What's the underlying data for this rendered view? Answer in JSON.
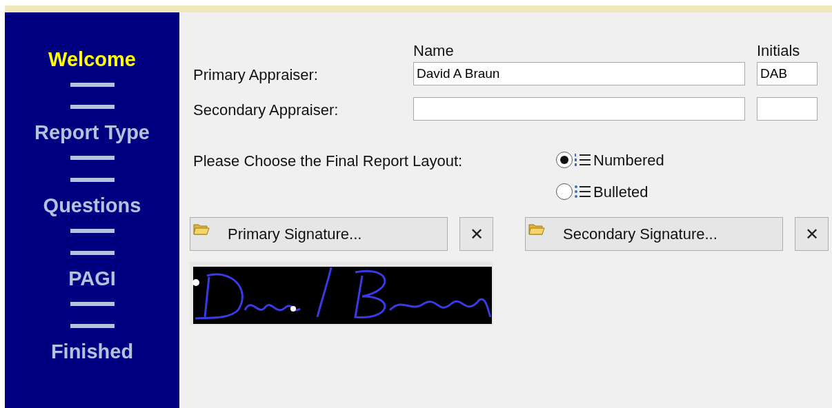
{
  "sidebar": {
    "items": [
      {
        "label": "Welcome",
        "selected": true
      },
      {
        "label": "Report Type",
        "selected": false
      },
      {
        "label": "Questions",
        "selected": false
      },
      {
        "label": "PAGI",
        "selected": false
      },
      {
        "label": "Finished",
        "selected": false
      }
    ]
  },
  "appraisers": {
    "name_header": "Name",
    "initials_header": "Initials",
    "rows": [
      {
        "label": "Primary Appraiser:",
        "name": "David A Braun",
        "initials": "DAB"
      },
      {
        "label": "Secondary Appraiser:"
      }
    ]
  },
  "report_layout": {
    "label": "Please Choose the Final Report Layout:",
    "options": [
      {
        "label": "Numbered",
        "kind": "numbered",
        "selected": true
      },
      {
        "label": "Bulleted",
        "kind": "bulleted",
        "selected": false
      }
    ]
  },
  "signatures": [
    {
      "button": "Primary Signature...",
      "clear": "✕"
    },
    {
      "button": "Secondary Signature...",
      "clear": "✕"
    }
  ]
}
